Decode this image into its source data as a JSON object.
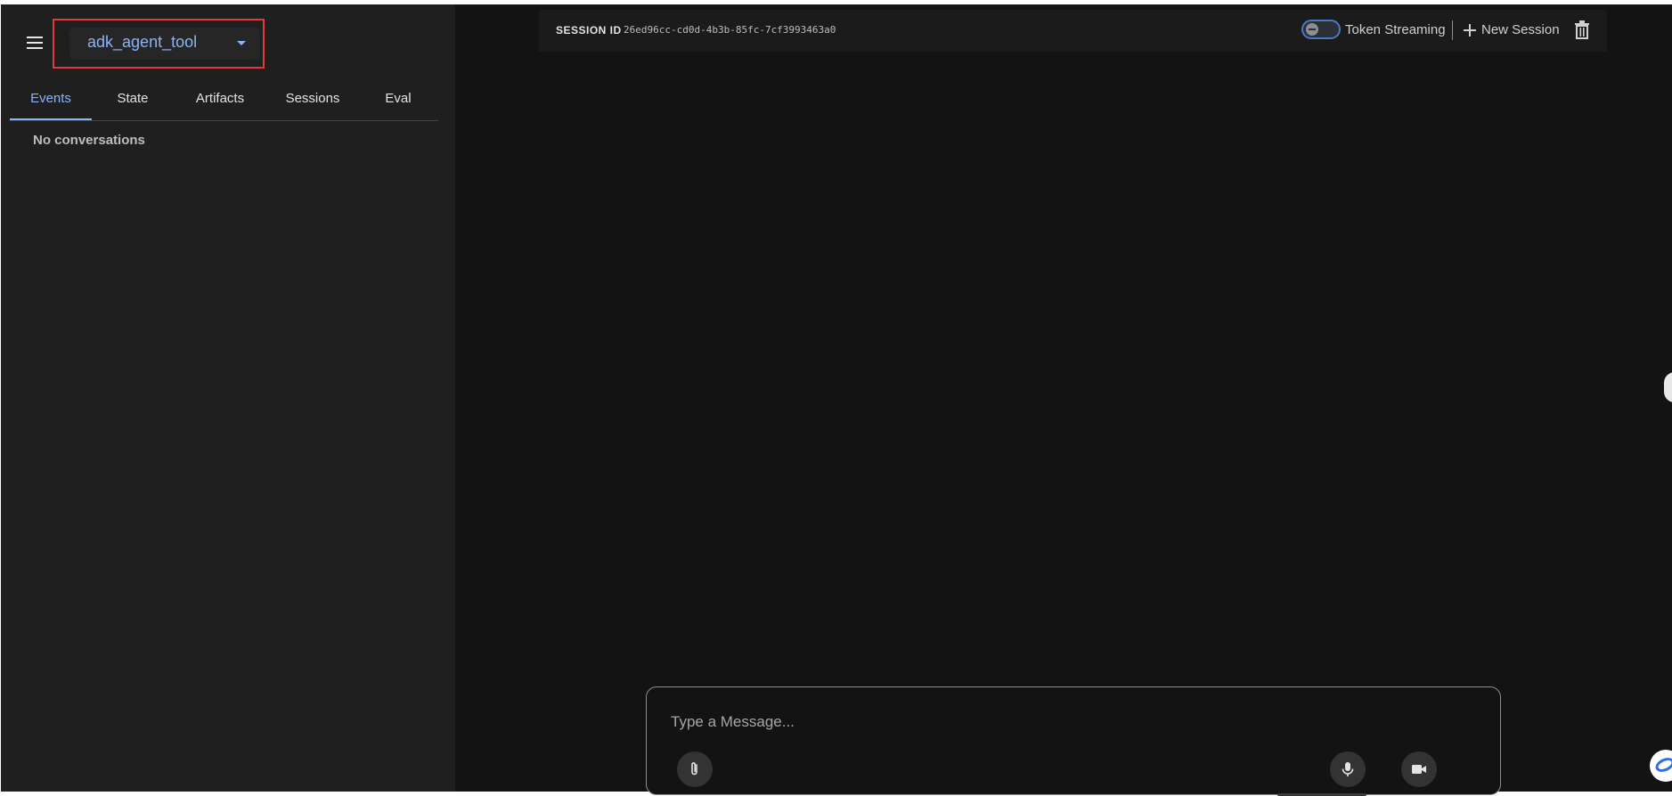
{
  "sidebar": {
    "agent_select": {
      "value": "adk_agent_tool"
    },
    "tabs": [
      {
        "label": "Events",
        "active": true
      },
      {
        "label": "State",
        "active": false
      },
      {
        "label": "Artifacts",
        "active": false
      },
      {
        "label": "Sessions",
        "active": false
      },
      {
        "label": "Eval",
        "active": false
      }
    ],
    "empty_message": "No conversations"
  },
  "session_bar": {
    "session_id_label": "SESSION ID",
    "session_id_value": "26ed96cc-cd0d-4b3b-85fc-7cf3993463a0",
    "token_streaming_label": "Token Streaming",
    "token_streaming_on": false,
    "new_session_label": "New Session"
  },
  "input": {
    "placeholder": "Type a Message...",
    "value": ""
  },
  "icons": {
    "menu": "menu-icon",
    "caret": "caret-down-icon",
    "toggle": "toggle-icon",
    "add": "plus-icon",
    "delete": "trash-icon",
    "attach": "paperclip-icon",
    "mic": "microphone-icon",
    "video": "video-camera-icon"
  },
  "colors": {
    "accent": "#8ab4f8",
    "highlight_border": "#e5383b",
    "sidebar_bg": "#1f1f1f",
    "main_bg": "#131313"
  }
}
